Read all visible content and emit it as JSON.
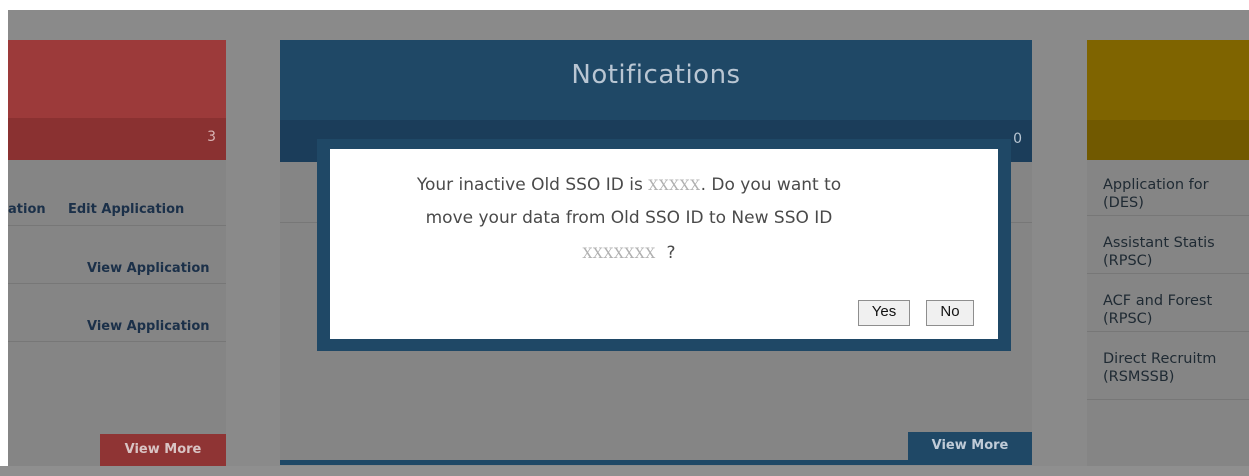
{
  "left_panel": {
    "count": "3",
    "rows": [
      {
        "left_link": "ation",
        "right_link": "Edit Application"
      },
      {
        "right_link": "View Application"
      },
      {
        "right_link": "View Application"
      }
    ],
    "view_more": "View More"
  },
  "notifications": {
    "title": "Notifications",
    "count": "0",
    "view_more": "View More"
  },
  "right_panel": {
    "items": [
      {
        "line1": "Application for",
        "line2": "(DES)"
      },
      {
        "line1": "Assistant Statis",
        "line2": "(RPSC)"
      },
      {
        "line1": "ACF and Forest",
        "line2": "(RPSC)"
      },
      {
        "line1": "Direct Recruitm",
        "line2": "(RSMSSB)"
      }
    ]
  },
  "dialog": {
    "line1_prefix": "Your inactive Old SSO ID is",
    "old_id": "XXXXX",
    "line1_suffix": ". Do you want to",
    "line2": "move your data from Old SSO ID to New SSO ID",
    "new_id": "XXXXXXX",
    "question_mark": "?",
    "yes_label": "Yes",
    "no_label": "No"
  },
  "colors": {
    "red_panel": "#9c3a3a",
    "blue_panel": "#1f4866",
    "gold_panel": "#7f6400",
    "overlay": "#8a8a8a"
  }
}
